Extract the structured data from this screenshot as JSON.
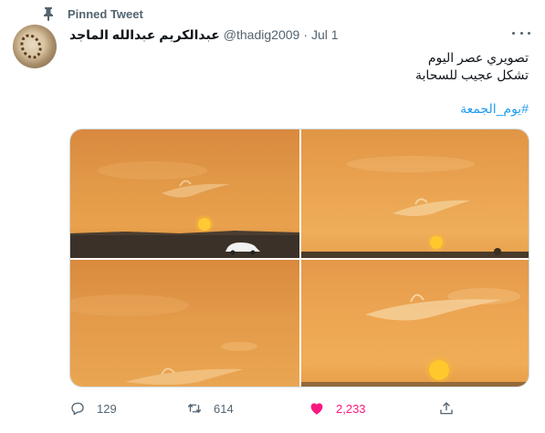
{
  "pinned": {
    "label": "Pinned Tweet",
    "icon": "pin-icon"
  },
  "author": {
    "display_name": "عبدالكريم عبدالله الماجد",
    "handle": "@thadig2009",
    "separator": "·",
    "date": "Jul 1"
  },
  "tweet": {
    "lines": [
      "تصويري عصر اليوم",
      "تشكل عجيب للسحابة"
    ],
    "hashtag": "#يوم_الجمعة"
  },
  "media": [
    {
      "icon": "sunset-photo"
    },
    {
      "icon": "sunset-photo"
    },
    {
      "icon": "sunset-photo"
    },
    {
      "icon": "sunset-photo"
    }
  ],
  "actions": {
    "reply_count": "129",
    "retweet_count": "614",
    "like_count": "2,233"
  },
  "colors": {
    "accent": "#1d9bf0",
    "like": "#f91880",
    "muted": "#536471"
  }
}
